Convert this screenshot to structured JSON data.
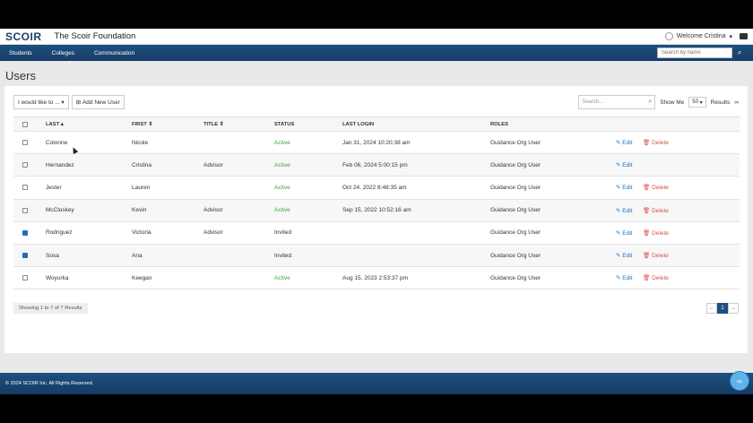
{
  "header": {
    "logo": "SCOIR",
    "org_name": "The Scoir Foundation",
    "welcome": "Welcome Cristina"
  },
  "nav": {
    "students": "Students",
    "colleges": "Colleges",
    "communication": "Communication",
    "search_placeholder": "Search by name"
  },
  "page": {
    "title": "Users"
  },
  "toolbar": {
    "action_menu": "I would like to ...",
    "add_new_user": "Add New User",
    "search_placeholder": "Search...",
    "show_me": "Show Me",
    "page_size": "50",
    "results": "Results"
  },
  "table": {
    "headers": [
      "LAST",
      "FIRST",
      "TITLE",
      "STATUS",
      "LAST LOGIN",
      "ROLES"
    ],
    "rows": [
      {
        "last": "Colonne",
        "first": "Nicole",
        "title": "",
        "status": "Active",
        "login": "Jan 31, 2024 10:20:38 am",
        "role": "Guidance Org User",
        "edit": "Edit",
        "delete": "Delete",
        "checked": false
      },
      {
        "last": "Hernandez",
        "first": "Cristina",
        "title": "Advisor",
        "status": "Active",
        "login": "Feb 06, 2024 5:00:15 pm",
        "role": "Guidance Org User",
        "edit": "Edit",
        "delete": "",
        "checked": false
      },
      {
        "last": "Jester",
        "first": "Lauren",
        "title": "",
        "status": "Active",
        "login": "Oct 24, 2022 8:48:35 am",
        "role": "Guidance Org User",
        "edit": "Edit",
        "delete": "Delete",
        "checked": false
      },
      {
        "last": "McCloskey",
        "first": "Kevin",
        "title": "Advisor",
        "status": "Active",
        "login": "Sep 15, 2022 10:52:16 am",
        "role": "Guidance Org User",
        "edit": "Edit",
        "delete": "Delete",
        "checked": false
      },
      {
        "last": "Rodriguez",
        "first": "Victoria",
        "title": "Advisor",
        "status": "Invited",
        "login": "",
        "role": "Guidance Org User",
        "edit": "Edit",
        "delete": "Delete",
        "checked": true
      },
      {
        "last": "Sosa",
        "first": "Ana",
        "title": "",
        "status": "Invited",
        "login": "",
        "role": "Guidance Org User",
        "edit": "Edit",
        "delete": "Delete",
        "checked": true
      },
      {
        "last": "Woyurka",
        "first": "Keegan",
        "title": "",
        "status": "Active",
        "login": "Aug 15, 2023 2:53:37 pm",
        "role": "Guidance Org User",
        "edit": "Edit",
        "delete": "Delete",
        "checked": false
      }
    ]
  },
  "pagination": {
    "showing": "Showing 1 to 7 of 7 Results",
    "prev": "←",
    "current": "1",
    "next": "→"
  },
  "footer": {
    "copyright": "© 2024 SCOIR Inc. All Rights Reserved."
  },
  "colors": {
    "brand": "#1d4f80",
    "active": "#3aa835",
    "delete": "#d9534f",
    "link": "#1e6fb8"
  }
}
